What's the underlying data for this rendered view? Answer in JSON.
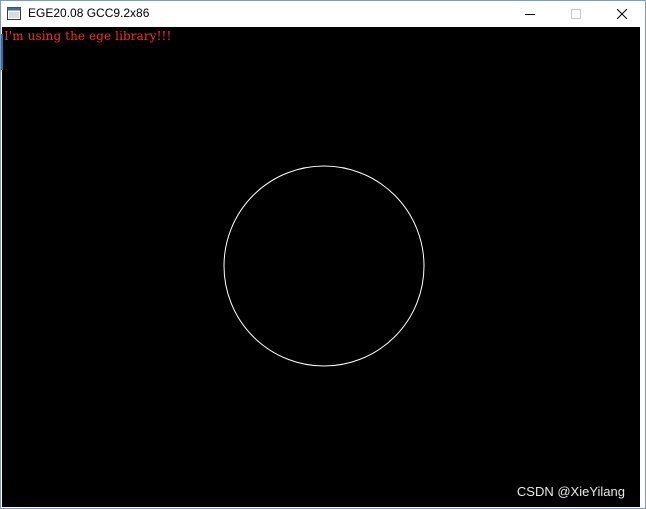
{
  "window": {
    "title": "EGE20.08 GCC9.2x86"
  },
  "caption_buttons": {
    "minimize_icon": "minimize-icon",
    "maximize_icon": "maximize-icon",
    "close_icon": "close-icon"
  },
  "canvas": {
    "background_color": "#000000",
    "text": "I'm using the ege library!!!",
    "text_color": "#ff2a2a",
    "shape": "circle",
    "circle_color": "#ffffff"
  },
  "watermark": {
    "text": "CSDN @XieYilang"
  }
}
